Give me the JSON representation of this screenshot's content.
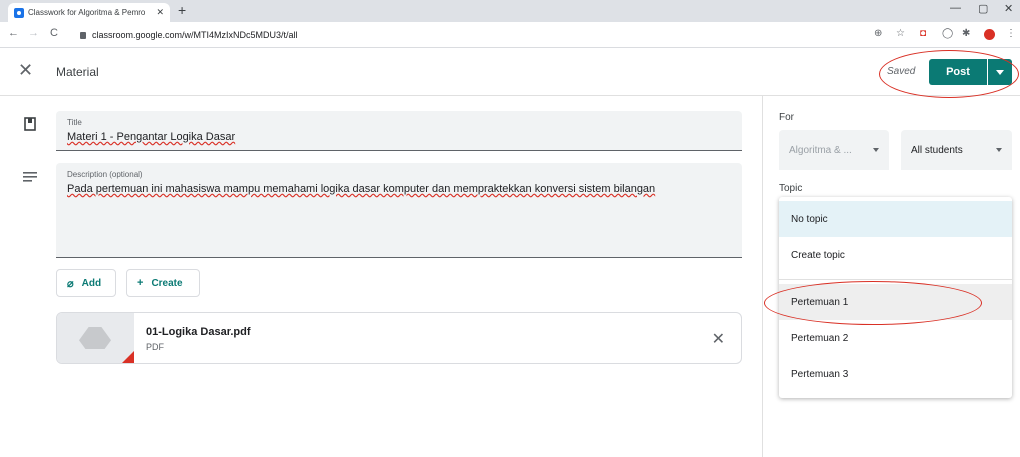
{
  "browser": {
    "tab_title": "Classwork for Algoritma & Pemro",
    "tab_close": "✕",
    "new_tab": "+",
    "url": "classroom.google.com/w/MTI4MzIxNDc5MDU3/t/all",
    "window_controls": {
      "minimize": "—",
      "maximize": "▢",
      "close": "✕"
    }
  },
  "header": {
    "title": "Material",
    "saved_label": "Saved",
    "post_label": "Post"
  },
  "form": {
    "title_label": "Title",
    "title_value": "Materi 1 - Pengantar Logika Dasar",
    "description_label": "Description (optional)",
    "description_value": "Pada pertemuan ini mahasiswa mampu memahami logika dasar komputer dan mempraktekkan konversi sistem bilangan",
    "add_label": "Add",
    "create_label": "Create"
  },
  "attachment": {
    "name": "01-Logika Dasar.pdf",
    "type": "PDF"
  },
  "sidebar": {
    "for_label": "For",
    "class_value": "Algoritma & ...",
    "students_value": "All students",
    "topic_label": "Topic",
    "topic_options": [
      "No topic",
      "Create topic",
      "Pertemuan 1",
      "Pertemuan 2",
      "Pertemuan 3"
    ]
  },
  "colors": {
    "accent": "#0b7a74",
    "annotation": "#d93025",
    "selected_option": "#e4f2f7"
  }
}
